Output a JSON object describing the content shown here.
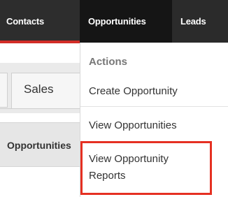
{
  "nav": {
    "contacts": "Contacts",
    "opportunities": "Opportunities",
    "leads": "Leads"
  },
  "page": {
    "tab_sales": "Sales",
    "list_header": "Opportunities"
  },
  "dropdown": {
    "header": "Actions",
    "create": "Create Opportunity",
    "view": "View Opportunities",
    "report": "View Opportunity Reports"
  },
  "colors": {
    "nav_bg": "#2b2b2b",
    "nav_active_bg": "#151515",
    "accent_red": "#d22d27",
    "highlight_border": "#e53022"
  }
}
